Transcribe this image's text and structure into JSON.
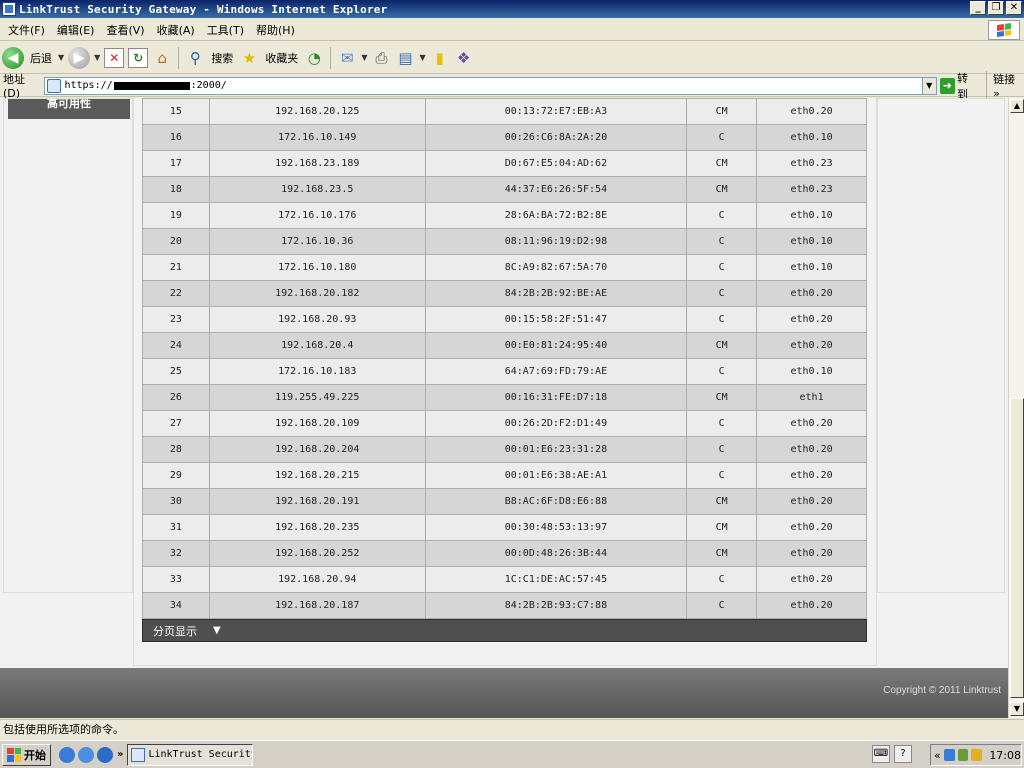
{
  "window": {
    "title": "LinkTrust Security Gateway - Windows Internet Explorer",
    "min": "_",
    "max": "❐",
    "close": "✕"
  },
  "menu": [
    "文件(F)",
    "编辑(E)",
    "查看(V)",
    "收藏(A)",
    "工具(T)",
    "帮助(H)"
  ],
  "toolbar": {
    "back_label": "后退",
    "search_label": "搜索",
    "favorites_label": "收藏夹"
  },
  "address": {
    "label": "地址(D)",
    "url_prefix": "https://",
    "url_suffix": ":2000/",
    "go_label": "转到",
    "links_label": "链接"
  },
  "sidebar": {
    "active_tab": "高可用性"
  },
  "table": {
    "rows": [
      {
        "idx": "15",
        "ip": "192.168.20.125",
        "mac": "00:13:72:E7:EB:A3",
        "flag": "CM",
        "iface": "eth0.20"
      },
      {
        "idx": "16",
        "ip": "172.16.10.149",
        "mac": "00:26:C6:8A:2A:20",
        "flag": "C",
        "iface": "eth0.10"
      },
      {
        "idx": "17",
        "ip": "192.168.23.189",
        "mac": "D0:67:E5:04:AD:62",
        "flag": "CM",
        "iface": "eth0.23"
      },
      {
        "idx": "18",
        "ip": "192.168.23.5",
        "mac": "44:37:E6:26:5F:54",
        "flag": "CM",
        "iface": "eth0.23"
      },
      {
        "idx": "19",
        "ip": "172.16.10.176",
        "mac": "28:6A:BA:72:B2:8E",
        "flag": "C",
        "iface": "eth0.10"
      },
      {
        "idx": "20",
        "ip": "172.16.10.36",
        "mac": "08:11:96:19:D2:98",
        "flag": "C",
        "iface": "eth0.10"
      },
      {
        "idx": "21",
        "ip": "172.16.10.180",
        "mac": "8C:A9:82:67:5A:70",
        "flag": "C",
        "iface": "eth0.10"
      },
      {
        "idx": "22",
        "ip": "192.168.20.182",
        "mac": "84:2B:2B:92:BE:AE",
        "flag": "C",
        "iface": "eth0.20"
      },
      {
        "idx": "23",
        "ip": "192.168.20.93",
        "mac": "00:15:58:2F:51:47",
        "flag": "C",
        "iface": "eth0.20"
      },
      {
        "idx": "24",
        "ip": "192.168.20.4",
        "mac": "00:E0:81:24:95:40",
        "flag": "CM",
        "iface": "eth0.20"
      },
      {
        "idx": "25",
        "ip": "172.16.10.183",
        "mac": "64:A7:69:FD:79:AE",
        "flag": "C",
        "iface": "eth0.10"
      },
      {
        "idx": "26",
        "ip": "119.255.49.225",
        "mac": "00:16:31:FE:D7:18",
        "flag": "CM",
        "iface": "eth1"
      },
      {
        "idx": "27",
        "ip": "192.168.20.109",
        "mac": "00:26:2D:F2:D1:49",
        "flag": "C",
        "iface": "eth0.20"
      },
      {
        "idx": "28",
        "ip": "192.168.20.204",
        "mac": "00:01:E6:23:31:28",
        "flag": "C",
        "iface": "eth0.20"
      },
      {
        "idx": "29",
        "ip": "192.168.20.215",
        "mac": "00:01:E6:38:AE:A1",
        "flag": "C",
        "iface": "eth0.20"
      },
      {
        "idx": "30",
        "ip": "192.168.20.191",
        "mac": "B8:AC:6F:D8:E6:88",
        "flag": "CM",
        "iface": "eth0.20"
      },
      {
        "idx": "31",
        "ip": "192.168.20.235",
        "mac": "00:30:48:53:13:97",
        "flag": "CM",
        "iface": "eth0.20"
      },
      {
        "idx": "32",
        "ip": "192.168.20.252",
        "mac": "00:0D:48:26:3B:44",
        "flag": "CM",
        "iface": "eth0.20"
      },
      {
        "idx": "33",
        "ip": "192.168.20.94",
        "mac": "1C:C1:DE:AC:57:45",
        "flag": "C",
        "iface": "eth0.20"
      },
      {
        "idx": "34",
        "ip": "192.168.20.187",
        "mac": "84:2B:2B:93:C7:88",
        "flag": "C",
        "iface": "eth0.20"
      }
    ]
  },
  "pager": {
    "label": "分页显示",
    "select_value": "▼"
  },
  "footer": {
    "copyright": "Copyright © 2011 Linktrust"
  },
  "statusbar": {
    "text": "包括使用所选项的命令。"
  },
  "taskbar": {
    "start_label": "开始",
    "chevron": "»",
    "task_title": "LinkTrust Security ...",
    "tray_chevron": "«",
    "clock": "17:08"
  },
  "colors": {
    "titlebar": "#0a246a",
    "table_row_odd": "#ececec",
    "table_row_even": "#d6d6d6",
    "pager_bg": "#4f4f4f",
    "footer_bg": "#666666"
  },
  "icons": [
    "app-icon",
    "back-icon",
    "forward-icon",
    "stop-icon",
    "refresh-icon",
    "home-icon",
    "search-icon",
    "favorites-star-icon",
    "history-icon",
    "mail-icon",
    "print-icon",
    "edit-icon",
    "note-icon",
    "research-icon",
    "page-icon",
    "go-arrow-icon",
    "windows-logo-icon",
    "start-flag-icon"
  ]
}
